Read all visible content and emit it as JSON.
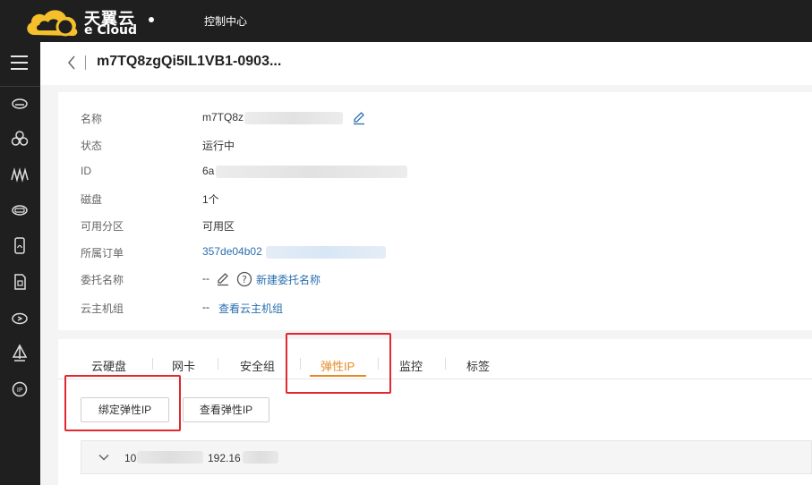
{
  "header": {
    "logo_cn": "天翼云",
    "logo_en": "e Cloud",
    "console_label": "控制中心"
  },
  "sidebar": {
    "icons": [
      "menu-icon",
      "cloud-host-icon",
      "cluster-icon",
      "network-icon",
      "storage-icon",
      "mobile-icon",
      "document-icon",
      "cloud-speed-icon",
      "sail-icon",
      "ip-icon"
    ]
  },
  "titlebar": {
    "title": "m7TQ8zgQi5IL1VB1-0903..."
  },
  "info": {
    "name_label": "名称",
    "name_value": "m7TQ8z",
    "status_label": "状态",
    "status_value": "运行中",
    "id_label": "ID",
    "id_value": "6a",
    "disk_label": "磁盘",
    "disk_value": "1个",
    "zone_label": "可用分区",
    "zone_value": "可用区",
    "order_label": "所属订单",
    "order_value": "357de04b02",
    "delegate_label": "委托名称",
    "delegate_value": "--",
    "delegate_link": "新建委托名称",
    "group_label": "云主机组",
    "group_value": "--",
    "group_link": "查看云主机组"
  },
  "tabs": [
    {
      "label": "云硬盘"
    },
    {
      "label": "网卡"
    },
    {
      "label": "安全组"
    },
    {
      "label": "弹性IP",
      "active": true
    },
    {
      "label": "监控"
    },
    {
      "label": "标签"
    }
  ],
  "actions": {
    "bind_eip": "绑定弹性IP",
    "view_eip": "查看弹性IP"
  },
  "eip_row": {
    "ip_prefix": "10",
    "ip_suffix": "192.16"
  },
  "colors": {
    "accent": "#e78a25",
    "link": "#2a6fb0",
    "highlight": "#e0282e",
    "topbar": "#1f1f1f"
  }
}
